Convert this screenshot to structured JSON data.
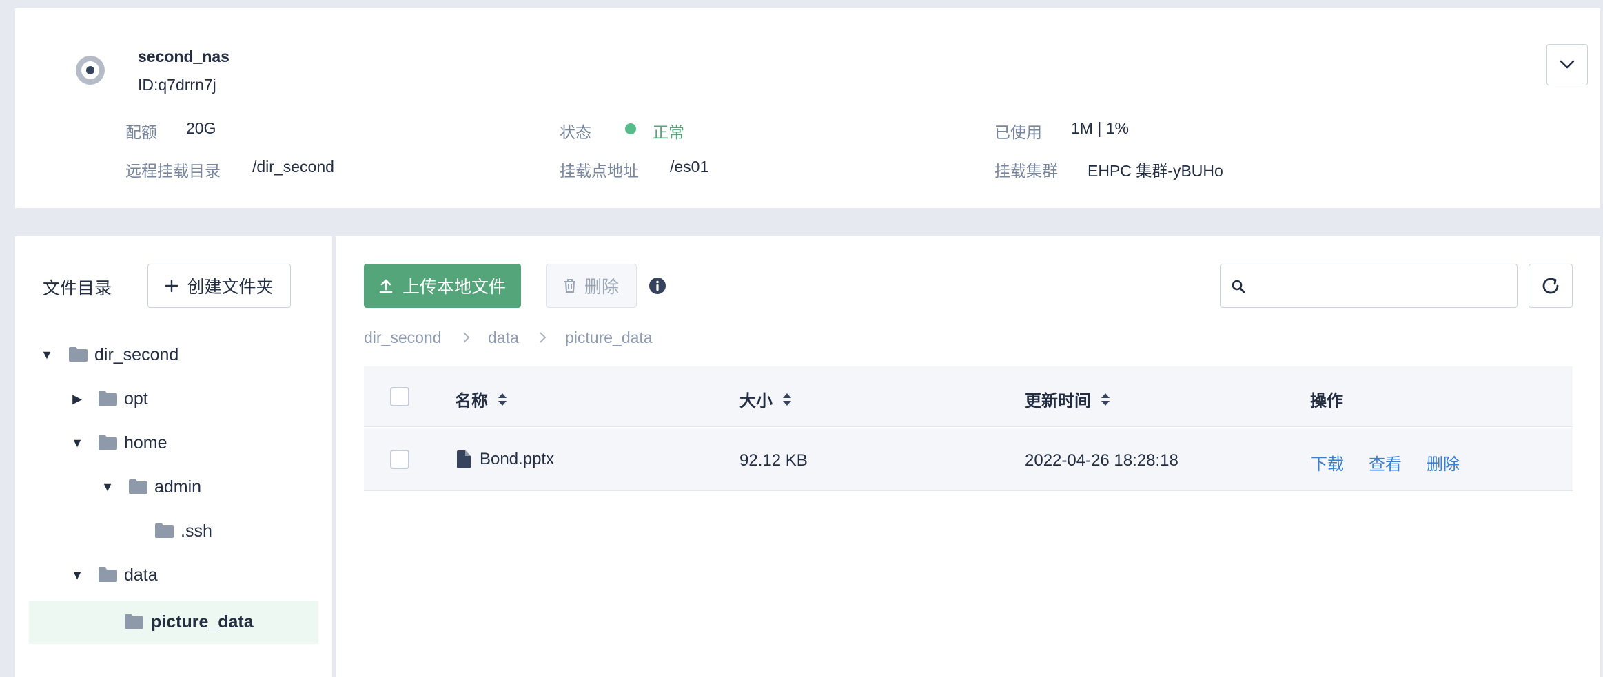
{
  "nas": {
    "name": "second_nas",
    "id": "ID:q7drrn7j",
    "fields": {
      "quota_label": "配额",
      "quota_value": "20G",
      "status_label": "状态",
      "status_value": "正常",
      "used_label": "已使用",
      "used_value": "1M | 1%",
      "remote_dir_label": "远程挂载目录",
      "remote_dir_value": "/dir_second",
      "mount_addr_label": "挂载点地址",
      "mount_addr_value": "/es01",
      "cluster_label": "挂载集群",
      "cluster_value": "EHPC 集群-yBUHo"
    },
    "status_color": "#55bc8a"
  },
  "tree": {
    "title": "文件目录",
    "new_folder_label": "创建文件夹",
    "items": [
      {
        "label": "dir_second",
        "state": "expanded"
      },
      {
        "label": "opt",
        "state": "collapsed"
      },
      {
        "label": "home",
        "state": "expanded"
      },
      {
        "label": "admin",
        "state": "expanded"
      },
      {
        "label": ".ssh",
        "state": "leaf"
      },
      {
        "label": "data",
        "state": "expanded"
      },
      {
        "label": "picture_data",
        "state": "selected"
      }
    ]
  },
  "toolbar": {
    "upload_label": "上传本地文件",
    "delete_label": "删除",
    "search_placeholder": ""
  },
  "breadcrumb": [
    "dir_second",
    "data",
    "picture_data"
  ],
  "table": {
    "columns": [
      "名称",
      "大小",
      "更新时间",
      "操作"
    ],
    "rows": [
      {
        "name": "Bond.pptx",
        "size": "92.12 KB",
        "updated": "2022-04-26 18:28:18",
        "actions": [
          "下载",
          "查看",
          "删除"
        ]
      }
    ]
  },
  "colors": {
    "primary_green": "#55a57a",
    "link_blue": "#3a7fd0",
    "page_bg": "#e6eaf0"
  }
}
